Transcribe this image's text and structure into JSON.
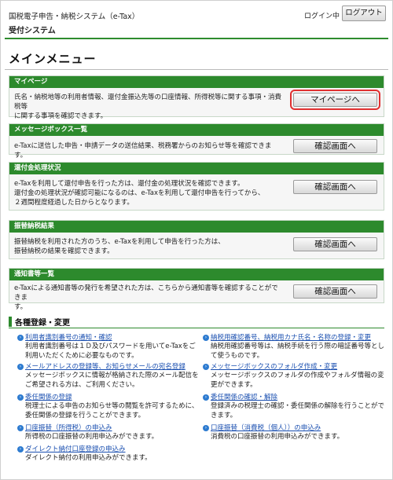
{
  "header": {
    "system_name": "国税電子申告・納税システム（e-Tax）",
    "subsystem": "受付システム",
    "login_status": "ログイン中",
    "logout_label": "ログアウト"
  },
  "page_title": "メインメニュー",
  "sections": [
    {
      "title": "マイページ",
      "text": [
        "氏名・納税地等の利用者情報、還付金振込先等の口座情報、所得税等に関する事項・消費税等",
        "に関する事項を確認できます。"
      ],
      "button": "マイページへ"
    },
    {
      "title": "メッセージボックス一覧",
      "text": [
        "e-Taxに送信した申告・申請データの送信結果、税務署からのお知らせ等を確認できます。"
      ],
      "button": "確認画面へ"
    },
    {
      "title": "還付金処理状況",
      "text": [
        "e-Taxを利用して還付申告を行った方は、還付金の処理状況を確認できます。",
        "還付金の処理状況が確認可能になるのは、e-Taxを利用して還付申告を行ってから、",
        "２週間程度経過した日からとなります。"
      ],
      "button": "確認画面へ"
    },
    {
      "title": "振替納税結果",
      "text": [
        "振替納税を利用された方のうち、e-Taxを利用して申告を行った方は、",
        "振替納税の結果を確認できます。"
      ],
      "button": "確認画面へ"
    },
    {
      "title": "通知書等一覧",
      "text": [
        "e-Taxによる通知書等の発行を希望された方は、こちらから通知書等を確認することができま",
        "す。"
      ],
      "button": "確認画面へ"
    }
  ],
  "registration": {
    "title": "各種登録・変更",
    "left": [
      {
        "link": "利用者識別番号の通知・確認",
        "desc": [
          "利用者識別番号は１Ｄ及びパスワードを用いてe-Taxをご",
          "利用いただくために必要なものです。"
        ]
      },
      {
        "link": "メールアドレスの登録等、お知らせメールの宛名登録",
        "desc": [
          "メッセージボックスに情報が格納された際のメール配信を",
          "ご希望される方は、ご利用ください。"
        ]
      },
      {
        "link": "委任関係の登録",
        "desc": [
          "税理士による申告のお知らせ等の閲覧を許可するために、",
          "委任関係の登録を行うことができます。"
        ]
      },
      {
        "link": "口座振替（所得税）の申込み",
        "desc": [
          "所得税の口座振替の利用申込みができます。"
        ]
      },
      {
        "link": "ダイレクト納付口座登録の申込み",
        "desc": [
          "ダイレクト納付の利用申込みができます。"
        ]
      }
    ],
    "right": [
      {
        "link": "納税用確認番号、納税用カナ氏名・名称の登録・変更",
        "desc": [
          "納税用確認番号等は、納税手続を行う際の暗証番号等とし",
          "て使うものです。"
        ]
      },
      {
        "link": "メッセージボックスのフォルダ作成・変更",
        "desc": [
          "メッセージボックスのフォルダの作成やフォルダ情報の変",
          "更ができます。"
        ]
      },
      {
        "link": "委任関係の確認・解除",
        "desc": [
          "登録済みの税理士の確認・委任関係の解除を行うことがで",
          "きます。"
        ]
      },
      {
        "link": "口座振替（消費税（個人））の申込み",
        "desc": [
          "消費税の口座振替の利用申込みができます。"
        ]
      }
    ]
  }
}
